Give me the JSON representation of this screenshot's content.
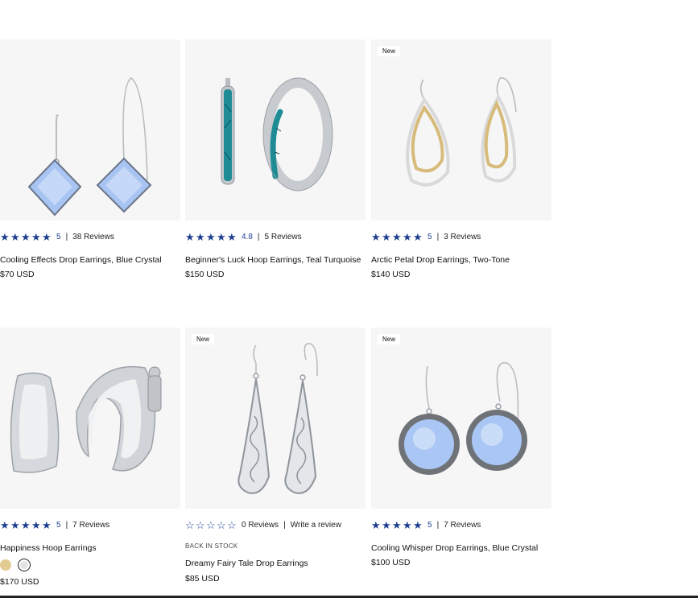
{
  "products": [
    {
      "name": "Cooling Effects Drop Earrings, Blue Crystal",
      "price": "$70 USD",
      "rating_value": 5,
      "rating_label": "5",
      "reviews": "38 Reviews",
      "badge": "",
      "image": "blue-crystal-diamond-drop-earrings"
    },
    {
      "name": "Beginner's Luck Hoop Earrings, Teal Turquoise",
      "price": "$150 USD",
      "rating_value": 4.8,
      "rating_label": "4.8",
      "reviews": "5 Reviews",
      "badge": "",
      "image": "teal-turquoise-hoop-earrings"
    },
    {
      "name": "Arctic Petal Drop Earrings, Two-Tone",
      "price": "$140 USD",
      "rating_value": 5,
      "rating_label": "5",
      "reviews": "3 Reviews",
      "badge": "New",
      "image": "two-tone-petal-drop-earrings"
    },
    {
      "name": "Happiness Hoop Earrings",
      "price": "$170 USD",
      "rating_value": 5,
      "rating_label": "5",
      "reviews": "7 Reviews",
      "badge": "",
      "image": "silver-wide-hoop-earrings",
      "swatches": [
        "gold",
        "silver"
      ]
    },
    {
      "name": "Dreamy Fairy Tale Drop Earrings",
      "price": "$85 USD",
      "rating_value": 0,
      "rating_label": "",
      "reviews": "0 Reviews",
      "write_review": "Write a review",
      "tag": "BACK IN STOCK",
      "badge": "New",
      "image": "filigree-teardrop-earrings"
    },
    {
      "name": "Cooling Whisper Drop Earrings, Blue Crystal",
      "price": "$100 USD",
      "rating_value": 5,
      "rating_label": "5",
      "reviews": "7 Reviews",
      "badge": "New",
      "image": "blue-crystal-round-drop-earrings"
    }
  ],
  "colors": {
    "star": "#1e3f8f",
    "image_bg": "#f6f6f6",
    "swatch_gold": "#e3cc93",
    "swatch_silver": "#e3e3e3"
  }
}
